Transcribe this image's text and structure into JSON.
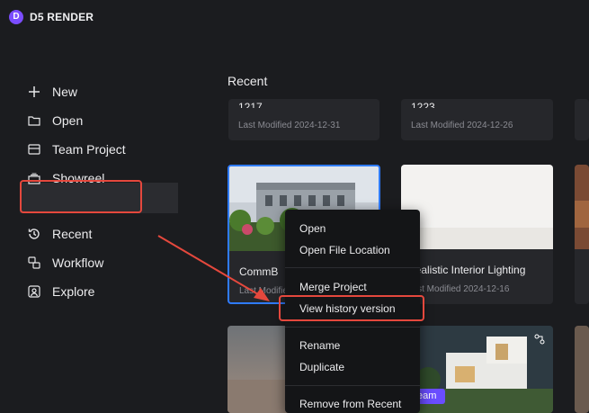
{
  "app": {
    "title": "D5 RENDER",
    "logo_letter": "D"
  },
  "sidebar": {
    "items": [
      {
        "label": "New",
        "icon": "plus-icon"
      },
      {
        "label": "Open",
        "icon": "folder-icon"
      },
      {
        "label": "Team Project",
        "icon": "team-project-icon"
      },
      {
        "label": "Showreel",
        "icon": "showreel-icon"
      },
      {
        "label": "Recent",
        "icon": "history-icon",
        "active": true
      },
      {
        "label": "Workflow",
        "icon": "workflow-icon"
      },
      {
        "label": "Explore",
        "icon": "explore-icon"
      }
    ]
  },
  "main": {
    "title": "Recent",
    "cards": [
      {
        "name": "1217",
        "modified": "Last Modified 2024-12-31"
      },
      {
        "name": "1223",
        "modified": "Last Modified 2024-12-26"
      },
      {
        "name": "CommB",
        "modified": "Last Modified"
      },
      {
        "name": "Realistic Interior Lighting",
        "modified": "Last Modified 2024-12-16"
      },
      {
        "name": "",
        "modified": ""
      },
      {
        "name": "",
        "modified": "",
        "badge": "eam"
      }
    ]
  },
  "context_menu": {
    "items": [
      "Open",
      "Open File Location",
      "Merge Project",
      "View history version",
      "Rename",
      "Duplicate",
      "Remove from Recent"
    ]
  },
  "colors": {
    "accent": "#2f7bff",
    "highlight": "#e5483d",
    "brand": "#7b4dff"
  }
}
